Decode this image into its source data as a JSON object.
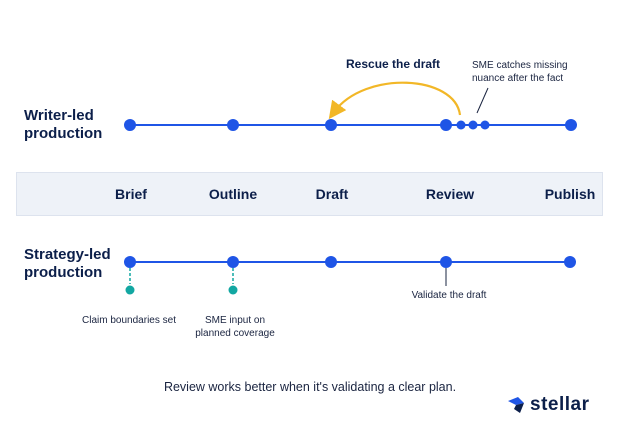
{
  "rows": {
    "writer": [
      "Writer-led",
      "production"
    ],
    "strategy": [
      "Strategy-led",
      "production"
    ]
  },
  "stages": [
    "Brief",
    "Outline",
    "Draft",
    "Review",
    "Publish"
  ],
  "annotations": {
    "rescue": "Rescue the draft",
    "sme_catches": [
      "SME catches missing",
      "nuance after the fact"
    ],
    "claim_boundaries": "Claim boundaries set",
    "sme_input": [
      "SME input on",
      "planned coverage"
    ],
    "validate": "Validate the draft"
  },
  "caption": "Review works better when it's validating a clear plan.",
  "logo": {
    "word": "stellar",
    "icon": "stellar-logo-icon"
  },
  "colors": {
    "line": "#1f55e6",
    "node": "#1f55e6",
    "teal": "#12a7a2",
    "arrow": "#f2b727",
    "text": "#0c1f4a",
    "band": "#eef2f8"
  }
}
